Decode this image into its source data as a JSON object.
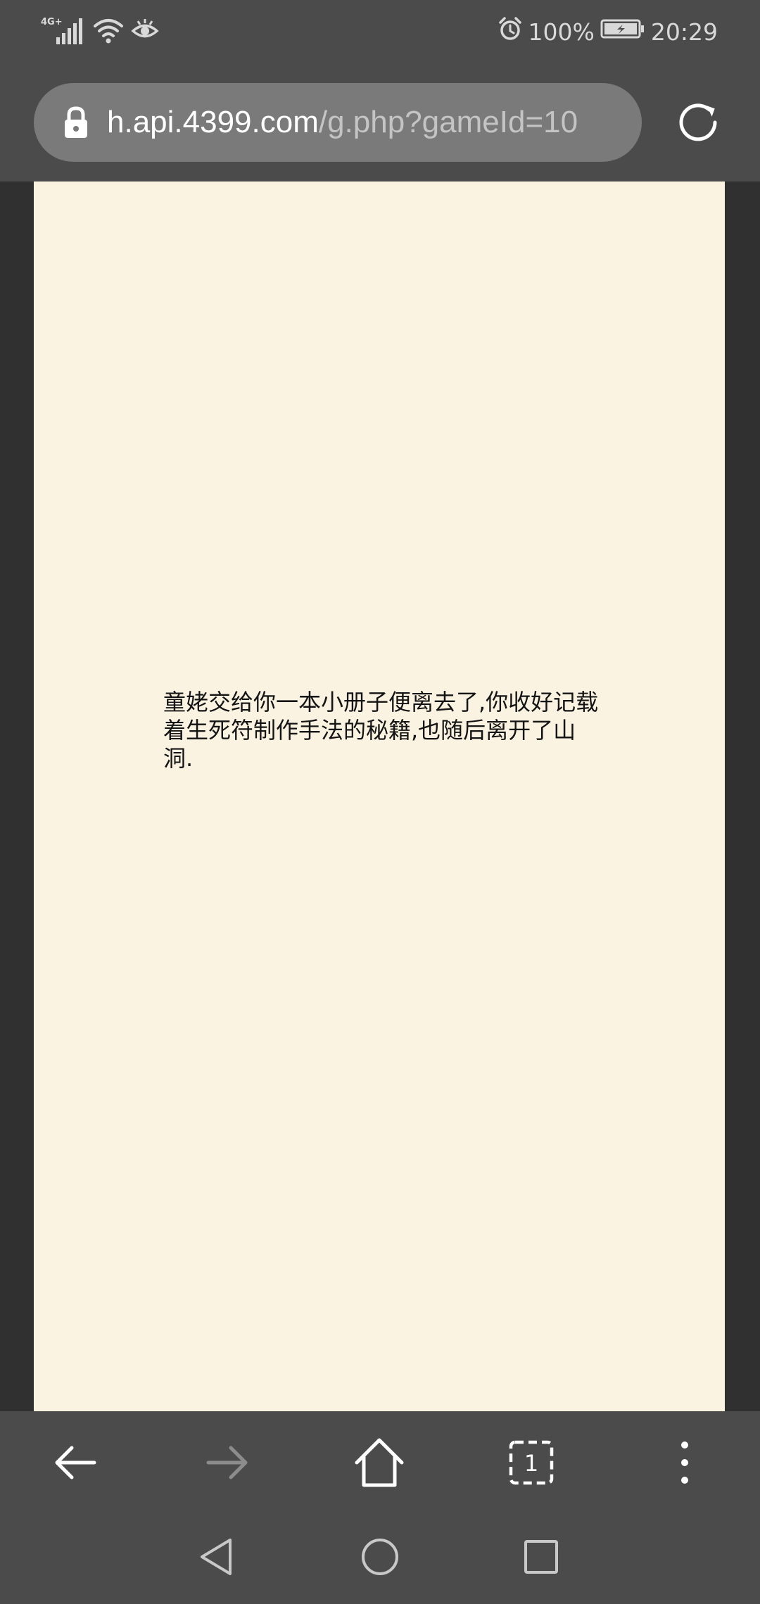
{
  "status_bar": {
    "network_label": "4G+",
    "battery_percent": "100%",
    "time": "20:29",
    "icons": [
      "signal-icon",
      "wifi-icon",
      "eye-comfort-icon",
      "alarm-icon",
      "battery-charging-icon"
    ]
  },
  "browser": {
    "url_host": "h.api.4399.com",
    "url_path": "/g.php?gameId=10",
    "secure": true
  },
  "game": {
    "story_text": "童姥交给你一本小册子便离去了,你收好记载着生死符制作手法的秘籍,也随后离开了山洞."
  },
  "toolbar": {
    "tab_count": "1",
    "buttons": [
      "back-icon",
      "forward-icon",
      "home-icon",
      "tabs-icon",
      "more-icon"
    ]
  },
  "nav": {
    "buttons": [
      "nav-back-icon",
      "nav-home-icon",
      "nav-recents-icon"
    ]
  },
  "colors": {
    "chrome_background": "#4b4b4b",
    "url_pill": "#7a7a7a",
    "canvas_background": "#fbf3e2",
    "text": "#141414"
  }
}
